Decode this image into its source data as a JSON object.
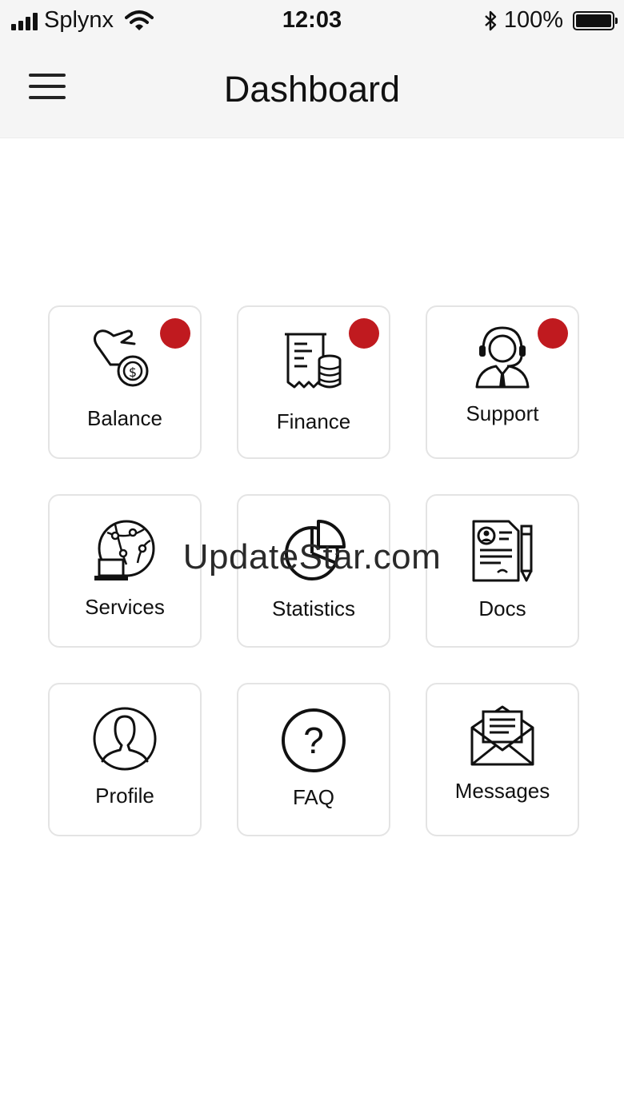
{
  "status_bar": {
    "carrier": "Splynx",
    "time": "12:03",
    "battery": "100%",
    "battery_level": 1.0
  },
  "header": {
    "title": "Dashboard"
  },
  "tiles": [
    {
      "label": "Balance",
      "icon": "balance-hand-coin-icon",
      "notification": true
    },
    {
      "label": "Finance",
      "icon": "finance-receipt-coins-icon",
      "notification": true
    },
    {
      "label": "Support",
      "icon": "support-headset-agent-icon",
      "notification": true
    },
    {
      "label": "Services",
      "icon": "services-globe-laptop-icon",
      "notification": false
    },
    {
      "label": "Statistics",
      "icon": "statistics-pie-chart-icon",
      "notification": false
    },
    {
      "label": "Docs",
      "icon": "docs-document-pencil-icon",
      "notification": false
    },
    {
      "label": "Profile",
      "icon": "profile-user-icon",
      "notification": false
    },
    {
      "label": "FAQ",
      "icon": "faq-question-icon",
      "notification": false
    },
    {
      "label": "Messages",
      "icon": "messages-envelope-icon",
      "notification": false
    }
  ],
  "colors": {
    "badge": "#c01a1f",
    "bar_background": "#f5f5f5",
    "tile_border": "#e4e4e4"
  },
  "watermark": "UpdateStar.com"
}
